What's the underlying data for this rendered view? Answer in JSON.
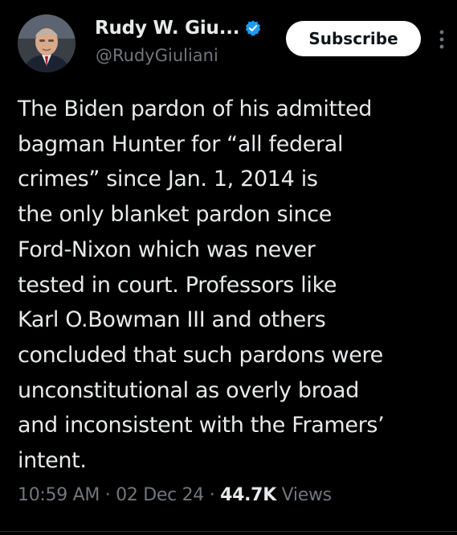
{
  "author": {
    "display_name": "Rudy W. Giu...",
    "handle": "@RudyGiuliani",
    "verified_icon": "verified-badge-icon",
    "avatar_icon": "profile-photo"
  },
  "actions": {
    "subscribe_label": "Subscribe",
    "more_icon": "more-vertical-icon"
  },
  "tweet": {
    "text": "The Biden pardon of his admitted\nbagman Hunter for “all federal\ncrimes” since Jan. 1, 2014 is\nthe only blanket pardon since\nFord-Nixon which was never\ntested in court. Professors like\nKarl O.Bowman III and others\nconcluded that such pardons were\nunconstitutional as overly broad\nand inconsistent with the Framers’\nintent."
  },
  "meta": {
    "time": "10:59 AM",
    "separator": "·",
    "date": "02 Dec 24",
    "views_count": "44.7K",
    "views_label": "Views"
  },
  "colors": {
    "background": "#000000",
    "text_primary": "#e7e9ea",
    "text_secondary": "#71767b",
    "verified_blue": "#1d9bf0",
    "button_bg": "#ffffff"
  }
}
